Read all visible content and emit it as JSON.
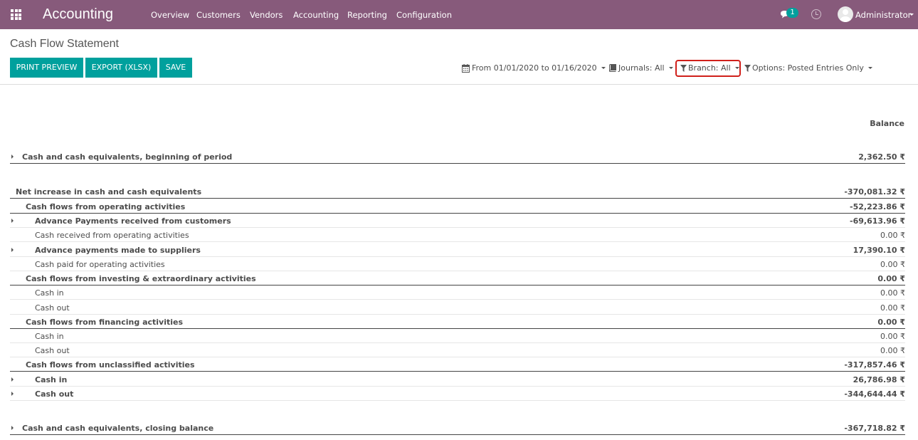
{
  "navbar": {
    "brand": "Accounting",
    "menu": [
      "Overview",
      "Customers",
      "Vendors",
      "Accounting",
      "Reporting",
      "Configuration"
    ],
    "chat_count": "1",
    "user": "Administrator",
    "icons": [
      "apps-grid-icon",
      "chat-icon",
      "clock-icon",
      "avatar"
    ]
  },
  "control_panel": {
    "title": "Cash Flow Statement",
    "buttons": {
      "print": "PRINT PREVIEW",
      "export": "EXPORT (XLSX)",
      "save": "SAVE"
    },
    "filters": {
      "date": "From 01/01/2020 to 01/16/2020",
      "journals": "Journals: All",
      "branch": "Branch: All",
      "options": "Options: Posted Entries Only"
    },
    "highlight_color": "#d0201b"
  },
  "report": {
    "column_header": "Balance",
    "lines": [
      {
        "label": "Cash and cash equivalents, beginning of period",
        "amount": "2,362.50 ₹"
      },
      {
        "label": "Net increase in cash and cash equivalents",
        "amount": "-370,081.32 ₹"
      },
      {
        "label": "Cash flows from operating activities",
        "amount": "-52,223.86 ₹"
      },
      {
        "label": "Advance Payments received from customers",
        "amount": "-69,613.96 ₹"
      },
      {
        "label": "Cash received from operating activities",
        "amount": "0.00 ₹"
      },
      {
        "label": "Advance payments made to suppliers",
        "amount": "17,390.10 ₹"
      },
      {
        "label": "Cash paid for operating activities",
        "amount": "0.00 ₹"
      },
      {
        "label": "Cash flows from investing & extraordinary activities",
        "amount": "0.00 ₹"
      },
      {
        "label": "Cash in",
        "amount": "0.00 ₹"
      },
      {
        "label": "Cash out",
        "amount": "0.00 ₹"
      },
      {
        "label": "Cash flows from financing activities",
        "amount": "0.00 ₹"
      },
      {
        "label": "Cash in",
        "amount": "0.00 ₹"
      },
      {
        "label": "Cash out",
        "amount": "0.00 ₹"
      },
      {
        "label": "Cash flows from unclassified activities",
        "amount": "-317,857.46 ₹"
      },
      {
        "label": "Cash in",
        "amount": "26,786.98 ₹"
      },
      {
        "label": "Cash out",
        "amount": "-344,644.44 ₹"
      },
      {
        "label": "Cash and cash equivalents, closing balance",
        "amount": "-367,718.82 ₹"
      }
    ]
  },
  "colors": {
    "navbar": "#875a7b",
    "primary_button": "#00a09d",
    "badge": "#00a09d"
  }
}
